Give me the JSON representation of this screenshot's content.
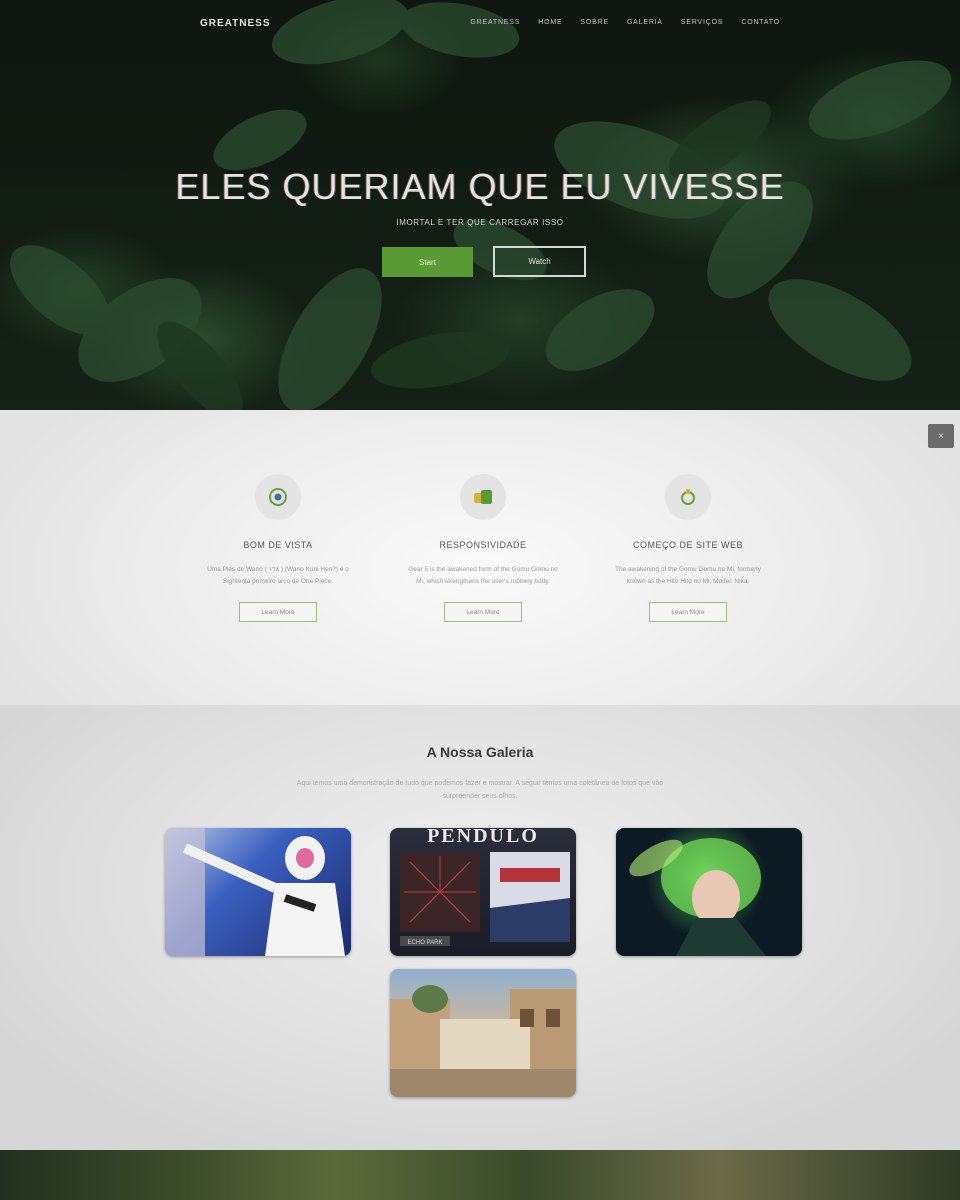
{
  "nav": {
    "brand": "GREATNESS",
    "items": [
      "GREATNESS",
      "HOME",
      "SOBRE",
      "GALERIA",
      "SERVIÇOS",
      "CONTATO"
    ]
  },
  "hero": {
    "title": "ELES QUERIAM QUE EU VIVESSE",
    "subtitle": "IMORTAL E TER QUE CARREGAR ISSO",
    "btn_primary": "Start",
    "btn_secondary": "Watch"
  },
  "features": {
    "close_label": "×",
    "items": [
      {
        "title": "BOM DE VISTA",
        "text": "Uma Pies de Wano ( ١٦٨ ) (Wano Kuni Hen?) é o Sightenta primeiro arco de One Piece.",
        "button": "Learn More"
      },
      {
        "title": "RESPONSIVIDADE",
        "text": "Gear 5 is the awakened form of the Gomu Gomu no Mi, which strengthens the user's rubbery body.",
        "button": "Learn More"
      },
      {
        "title": "COMEÇO DE SITE WEB",
        "text": "The awakening of the Gomu Gomu no Mi, formerly known as the Hito Hito no Mi, Model: Nika.",
        "button": "Learn More"
      }
    ]
  },
  "gallery": {
    "title": "A Nossa Galeria",
    "description": "Aqui temos uma demonstração de tudo que podemos fazer e mostrar. A seguir temos uma coletânea de fotos que vão surpreender seus olhos.",
    "images": [
      "spider-gwen",
      "pendulo",
      "green-hair-champion",
      "city-street"
    ],
    "pendulo_title": "PENDULO",
    "pendulo_caption": "ECHO PARK"
  },
  "colors": {
    "accent_green": "#5a9a34",
    "nav_text": "#c8c8c8",
    "hero_title": "#e9e3df"
  }
}
